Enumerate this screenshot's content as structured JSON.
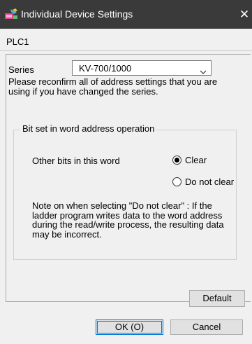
{
  "window": {
    "title": "Individual Device Settings",
    "close_glyph": "✕",
    "icons": [
      "app-icon",
      "close-icon",
      "chevron-down-icon"
    ]
  },
  "device": {
    "name": "PLC1"
  },
  "series": {
    "label": "Series",
    "selected": "KV-700/1000",
    "notice": "Please reconfirm all of address settings that you are using if you have changed the series."
  },
  "bit_set_group": {
    "title": "Bit set in word address operation",
    "other_bits_label": "Other bits in this word",
    "options": [
      {
        "label": "Clear",
        "selected": true
      },
      {
        "label": "Do not clear",
        "selected": false
      }
    ],
    "note": "Note on when selecting \"Do not clear\" : If the ladder program writes data to the word address during the read/write process, the resulting data may be incorrect."
  },
  "buttons": {
    "default": "Default",
    "ok": "OK (O)",
    "cancel": "Cancel"
  },
  "colors": {
    "titlebar": "#3a3a3a",
    "dialog_bg": "#f0f0f0",
    "button_bg": "#e1e1e1",
    "focus_accent": "#0078d7"
  }
}
